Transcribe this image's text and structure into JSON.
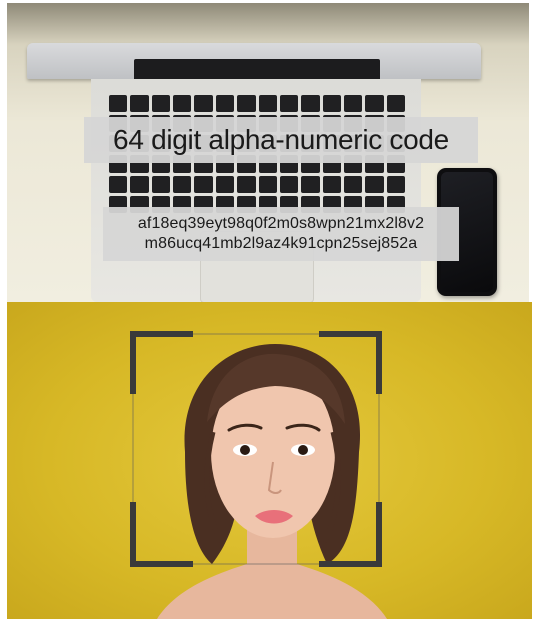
{
  "overlay": {
    "title": "64 digit alpha-numeric code",
    "code_line_1": "af18eq39eyt98q0f2m0s8wpn21mx2l8v2",
    "code_line_2": "m86ucq41mb2l9az4k91cpn25sej852a"
  },
  "colors": {
    "overlay_box": "#d6d6d6",
    "overlay_text": "#1a1a1a",
    "bottom_background": "#d7b826",
    "scan_bracket": "#3a3a3a"
  },
  "icons": {
    "face_frame": "face-scan-frame-icon"
  }
}
